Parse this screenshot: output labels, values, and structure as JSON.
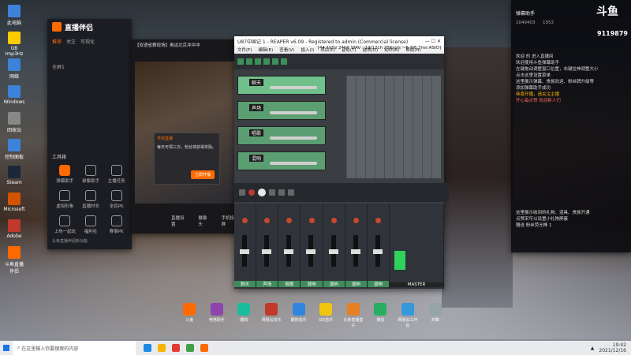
{
  "desktop": {
    "icons": [
      {
        "label": "此电脑",
        "color": "#3c82d8"
      },
      {
        "label": "GB Imp3Hz",
        "color": "#ffcc00"
      },
      {
        "label": "网络",
        "color": "#3c82d8"
      },
      {
        "label": "Windows",
        "color": "#3c82d8"
      },
      {
        "label": "回收站",
        "color": "#888888"
      },
      {
        "label": "控制面板",
        "color": "#3c82d8"
      },
      {
        "label": "Steam",
        "color": "#1b2838"
      },
      {
        "label": "Microsoft",
        "color": "#d35400"
      },
      {
        "label": "Adobe",
        "color": "#c0392b"
      },
      {
        "label": "斗鱼直播伴侣",
        "color": "#ff6a00"
      }
    ]
  },
  "zhibo": {
    "title": "直播伴侣",
    "tabs": [
      "推荐",
      "关注",
      "可视化"
    ],
    "section": "全屏1",
    "tool_label": "工具箱",
    "grid": [
      {
        "label": "弹幕助手",
        "on": true
      },
      {
        "label": "录像助手",
        "on": false
      },
      {
        "label": "主播任务",
        "on": false
      },
      {
        "label": "虚拟形象",
        "on": false
      },
      {
        "label": "直播时长",
        "on": false
      },
      {
        "label": "全民PK",
        "on": false
      },
      {
        "label": "上热一起玩",
        "on": false
      },
      {
        "label": "福利社",
        "on": false
      },
      {
        "label": "赛事PK",
        "on": false
      }
    ],
    "footer": "头条直播伴侣新功能",
    "stage_title": "【双语省赛现场】奥运北京冲冲冲",
    "dialog_title": "开启直播",
    "dialog_text": "每天可领三次，粉丝将获得奖励。",
    "dialog_button": "立即开播",
    "bottom_buttons": [
      "直播设置",
      "摄像头",
      "手机投屏"
    ]
  },
  "reaper": {
    "title": "U87中国记 1 - REAPER v6.09 - Registered to admin (Commercial license)",
    "menu": [
      "文件(F)",
      "编辑(E)",
      "查看(V)",
      "插入(I)",
      "项目(P)",
      "音轨(T)",
      "选项(O)",
      "动作(A)",
      "帮助(H)"
    ],
    "status": "[44.1kHz 24bit WAV : 12/12ch 256spls ~6.3/6.7ms ASIO]",
    "tracks": [
      {
        "name": "聊天",
        "selected": true
      },
      {
        "name": "声场",
        "selected": false
      },
      {
        "name": "唱歌",
        "selected": false
      },
      {
        "name": "混响",
        "selected": false
      }
    ],
    "mixer": [
      "聊天",
      "声场",
      "唱歌",
      "混响",
      "混响",
      "混响",
      "混响",
      "MASTER"
    ]
  },
  "panel": {
    "brand": "斗鱼",
    "room_id": "9119879",
    "header_name": "弹幕助手",
    "stat1": "1049403",
    "stat2": "1553",
    "messages": [
      {
        "text": "欢迎 的 进入直播间",
        "cls": ""
      },
      {
        "text": "欢迎使用斗鱼弹幕助手",
        "cls": ""
      },
      {
        "text": "左键拖动调整窗口位置，右键拉伸调整大小",
        "cls": ""
      },
      {
        "text": "点击这里设置菜单",
        "cls": ""
      },
      {
        "text": "这里展示弹幕、贵族欢迎、粉丝牌升级等",
        "cls": ""
      },
      {
        "text": "添加弹幕助手成功",
        "cls": ""
      },
      {
        "text": "恭喜开播，请关注主播",
        "cls": "o"
      },
      {
        "text": "开心每点赞 欢迎新人们",
        "cls": "r"
      }
    ],
    "bottom": [
      "这里展示收到的礼物、道具、贵族开通",
      "点赞宋可以设置小礼物屏蔽",
      "赠送 粉丝荧光棒 1"
    ]
  },
  "dock": [
    {
      "label": "斗鱼",
      "color": "#ff6a00"
    },
    {
      "label": "电竞助手",
      "color": "#8e44ad"
    },
    {
      "label": "酷狗",
      "color": "#1abc9c"
    },
    {
      "label": "网易云音乐",
      "color": "#c0392b"
    },
    {
      "label": "酷狗音乐",
      "color": "#2e86de"
    },
    {
      "label": "QQ音乐",
      "color": "#f1c40f"
    },
    {
      "label": "头条直播盒子",
      "color": "#e67e22"
    },
    {
      "label": "微信",
      "color": "#27ae60"
    },
    {
      "label": "网易云工作台",
      "color": "#3498db"
    },
    {
      "label": "天降",
      "color": "#95a5a6"
    }
  ],
  "taskbar": {
    "search_placeholder": "在这里输入你要搜索的内容",
    "time": "19:42",
    "date": "2021/12/16"
  }
}
